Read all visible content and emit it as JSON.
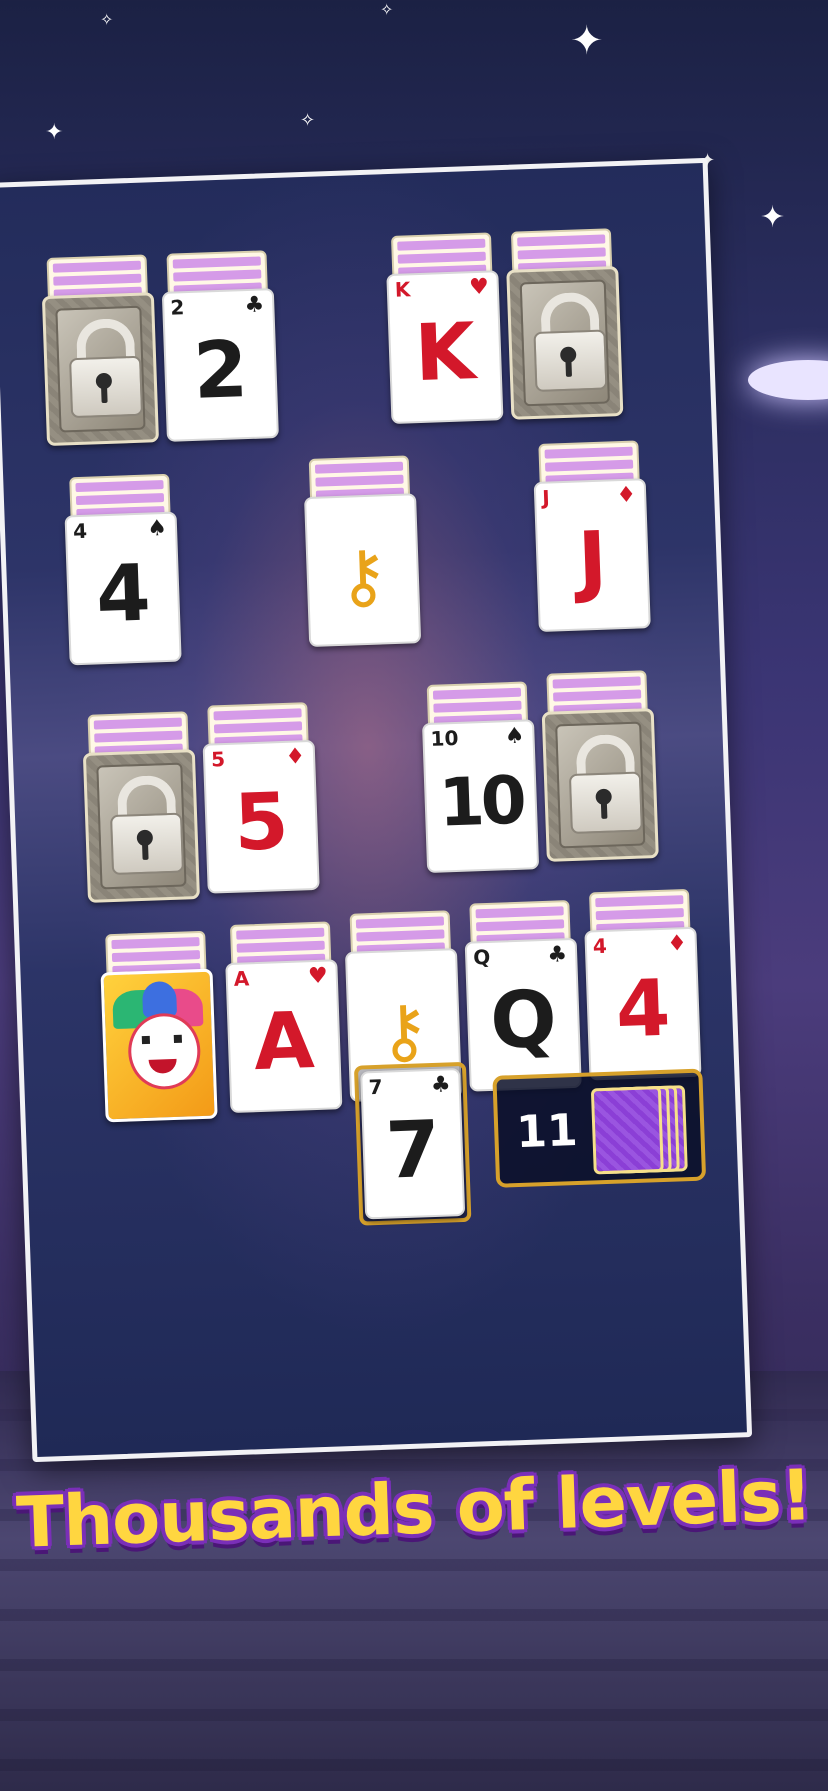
{
  "background": {
    "sky_colors": [
      "#1b2144",
      "#4b3c7c",
      "#2a2548"
    ],
    "stars": [
      "✦",
      "✦",
      "✧",
      "✦",
      "✧",
      "✦",
      "✧"
    ]
  },
  "board": {
    "rows": [
      {
        "piles": [
          {
            "type": "locked",
            "icon": "lock-icon"
          },
          {
            "type": "card",
            "rank": "2",
            "suit": "♣",
            "color": "black"
          },
          {
            "type": "card",
            "rank": "K",
            "suit": "♥",
            "color": "red"
          },
          {
            "type": "locked",
            "icon": "lock-icon"
          }
        ]
      },
      {
        "piles": [
          {
            "type": "card",
            "rank": "4",
            "suit": "♠",
            "color": "black"
          },
          {
            "type": "key",
            "icon": "key-icon"
          },
          {
            "type": "card",
            "rank": "J",
            "suit": "♦",
            "color": "red"
          }
        ]
      },
      {
        "piles": [
          {
            "type": "locked",
            "icon": "lock-icon"
          },
          {
            "type": "card",
            "rank": "5",
            "suit": "♦",
            "color": "red"
          },
          {
            "type": "card",
            "rank": "10",
            "suit": "♠",
            "color": "black"
          },
          {
            "type": "locked",
            "icon": "lock-icon"
          }
        ]
      },
      {
        "piles": [
          {
            "type": "joker",
            "icon": "joker-icon"
          },
          {
            "type": "card",
            "rank": "A",
            "suit": "♥",
            "color": "red"
          },
          {
            "type": "key",
            "icon": "key-icon"
          },
          {
            "type": "card",
            "rank": "Q",
            "suit": "♣",
            "color": "black"
          },
          {
            "type": "card",
            "rank": "4",
            "suit": "♦",
            "color": "red"
          }
        ]
      }
    ],
    "waste_card": {
      "rank": "7",
      "suit": "♣",
      "color": "black"
    },
    "stock": {
      "count": "11",
      "icon": "card-back-icon"
    }
  },
  "headline": "Thousands of levels!",
  "colors": {
    "red_suit": "#d3182a",
    "black_suit": "#1c1c1c",
    "headline_fill": "#ffd640",
    "headline_outline": "#7a2fb8",
    "frame_gold": "#d7a12b",
    "stack_stripe": "#d59be8"
  }
}
